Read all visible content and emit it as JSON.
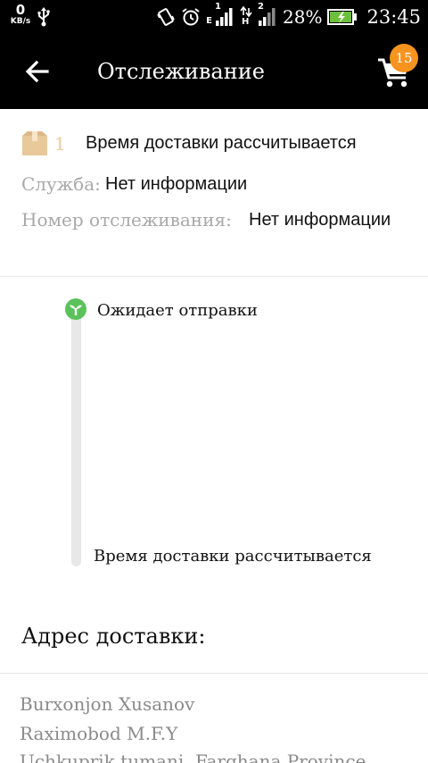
{
  "status_bar": {
    "speed_value": "0",
    "speed_unit": "KB/s",
    "sim1_network": "E",
    "sim1_index": "1",
    "sim2_network": "H",
    "sim2_index": "2",
    "battery_percent": "28%",
    "time": "23:45"
  },
  "toolbar": {
    "title": "Отслеживание",
    "cart_count": "15",
    "colors": {
      "background": "#000000",
      "badge": "#f7931e"
    }
  },
  "tracking": {
    "package_count": "1",
    "package_status": "Время доставки рассчитывается",
    "service_label": "Служба:",
    "service_value": "Нет информации",
    "tracking_label": "Номер отслеживания:",
    "tracking_value": "Нет информации"
  },
  "timeline": {
    "steps": [
      {
        "label": "Ожидает отправки",
        "state": "active",
        "color": "#5bc25b"
      },
      {
        "label": "Время доставки рассчитывается",
        "state": "pending"
      }
    ]
  },
  "address": {
    "heading": "Адрес доставки:",
    "lines": [
      "Burxonjon Xusanov",
      "Raximobod M.F.Y",
      "Uchkuprik tumani, Farghana Province"
    ]
  }
}
